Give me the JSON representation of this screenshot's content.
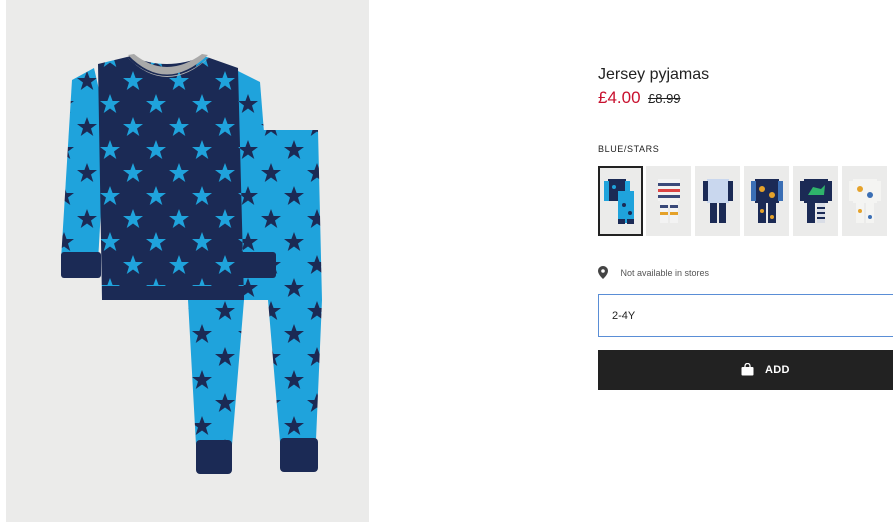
{
  "product": {
    "title": "Jersey pyjamas",
    "sale_price": "£4.00",
    "original_price": "£8.99",
    "color_label": "BLUE/STARS",
    "image_alt_icon": "pyjamas-image",
    "swatches": [
      {
        "name": "blue-stars",
        "selected": true
      },
      {
        "name": "white-stripes-print",
        "selected": false
      },
      {
        "name": "light-blue-navy",
        "selected": false
      },
      {
        "name": "navy-print",
        "selected": false
      },
      {
        "name": "navy-dinosaur",
        "selected": false
      },
      {
        "name": "white-print",
        "selected": false
      }
    ],
    "availability_icon": "location-pin-icon",
    "availability_text": "Not available in stores",
    "size_value": "2-4Y",
    "add_icon": "shopping-bag-icon",
    "add_label": "ADD"
  },
  "colors": {
    "sale": "#c8102e",
    "navy": "#1b2a55",
    "light_blue": "#1fa3dc",
    "button": "#222222",
    "select_border": "#5a8ed6"
  }
}
